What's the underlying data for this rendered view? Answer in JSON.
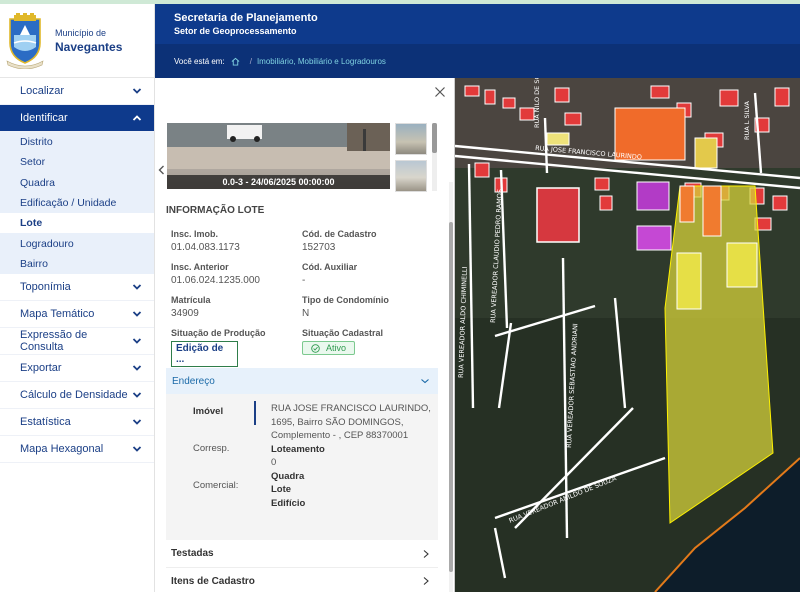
{
  "logo": {
    "small": "Município de",
    "big": "Navegantes",
    "seal_text": "NAVEGANTES"
  },
  "header": {
    "title": "Secretaria de Planejamento",
    "subtitle": "Setor de Geoprocessamento",
    "crumb_label": "Você está em:",
    "crumb_sep": "/",
    "crumb_link": "Imobiliário, Mobiliário e Logradouros"
  },
  "nav": {
    "localizar": "Localizar",
    "identificar": "Identificar",
    "sub": [
      "Distrito",
      "Setor",
      "Quadra",
      "Edificação / Unidade",
      "Lote",
      "Logradouro",
      "Bairro"
    ],
    "after": [
      "Toponímia",
      "Mapa Temático",
      "Expressão de Consulta",
      "Exportar",
      "Cálculo de Densidade",
      "Estatística",
      "Mapa Hexagonal"
    ]
  },
  "panel": {
    "photo_caption": "0.0-3 - 24/06/2025 00:00:00",
    "section_title": "INFORMAÇÃO LOTE",
    "fields": {
      "insc_imob": {
        "label": "Insc. Imob.",
        "value": "01.04.083.1173"
      },
      "cod_cadastro": {
        "label": "Cód. de Cadastro",
        "value": "152703"
      },
      "insc_anterior": {
        "label": "Insc. Anterior",
        "value": "01.06.024.1235.000"
      },
      "cod_auxiliar": {
        "label": "Cód. Auxiliar",
        "value": "-"
      },
      "matricula": {
        "label": "Matrícula",
        "value": "34909"
      },
      "tipo_condominio": {
        "label": "Tipo de Condomínio",
        "value": "N"
      },
      "situacao_producao": {
        "label": "Situação de Produção",
        "value": "Edição de ..."
      },
      "situacao_cadastral": {
        "label": "Situação Cadastral",
        "value": "Ativo"
      }
    },
    "endereco": {
      "title": "Endereço",
      "tabs": [
        "Imóvel",
        "Corresp.",
        "Comercial:"
      ],
      "address": "RUA JOSE FRANCISCO LAURINDO, 1695, Bairro SÃO DOMINGOS, Complemento - , CEP 88370001",
      "loteamento_label": "Loteamento",
      "loteamento_value": "0",
      "quadra_label": "Quadra",
      "lote_label": "Lote",
      "edificio_label": "Edifício"
    },
    "testadas": "Testadas",
    "itens_cadastro": "Itens de Cadastro"
  },
  "map": {
    "streets": [
      "RUA JOSE FRANCISCO LAURINDO",
      "RUA VEREADOR ALDO CHIMINELLI",
      "RUA VEREADOR CLAUDIO PEDRO RAMOS",
      "RUA VEREADOR SEBASTIAO ANDRIANI",
      "RUA VEREADOR ANILDO DE SOUZA",
      "RUA NILO DE SOUZA",
      "RUA L SILVA"
    ]
  }
}
